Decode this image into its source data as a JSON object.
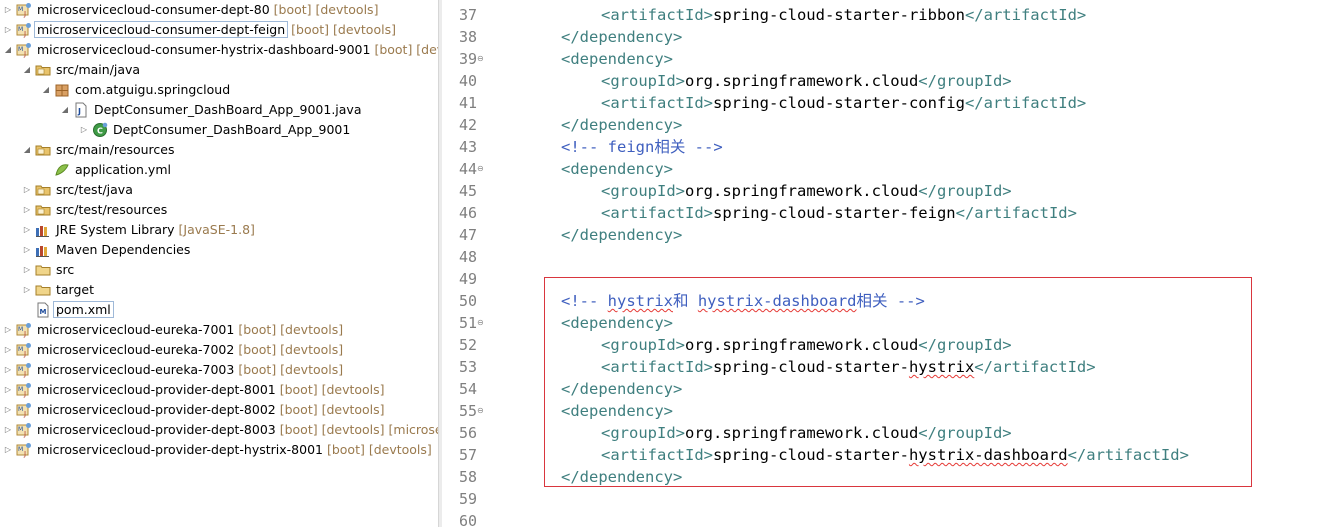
{
  "explorer": {
    "rows": [
      {
        "label": "microservicecloud-consumer-dept-80",
        "dec": " [boot] [devtools]",
        "twisty": "▷",
        "icon": "maven-project-icon",
        "indent": 0
      },
      {
        "label": "microservicecloud-consumer-dept-feign",
        "dec": " [boot] [devtools]",
        "twisty": "▷",
        "icon": "maven-project-icon",
        "indent": 0,
        "selected": true
      },
      {
        "label": "microservicecloud-consumer-hystrix-dashboard-9001",
        "dec": " [boot] [devtoo",
        "twisty": "◢",
        "icon": "maven-project-icon",
        "indent": 0
      },
      {
        "label": "src/main/java",
        "dec": "",
        "twisty": "◢",
        "icon": "source-folder-icon",
        "indent": 1
      },
      {
        "label": "com.atguigu.springcloud",
        "dec": "",
        "twisty": "◢",
        "icon": "package-icon",
        "indent": 2
      },
      {
        "label": "DeptConsumer_DashBoard_App_9001.java",
        "dec": "",
        "twisty": "◢",
        "icon": "java-file-icon",
        "indent": 3
      },
      {
        "label": "DeptConsumer_DashBoard_App_9001",
        "dec": "",
        "twisty": "▷",
        "icon": "java-class-icon",
        "indent": 4
      },
      {
        "label": "src/main/resources",
        "dec": "",
        "twisty": "◢",
        "icon": "source-folder-icon",
        "indent": 1
      },
      {
        "label": "application.yml",
        "dec": "",
        "twisty": "",
        "icon": "yml-file-icon",
        "indent": 2
      },
      {
        "label": "src/test/java",
        "dec": "",
        "twisty": "▷",
        "icon": "source-folder-icon",
        "indent": 1
      },
      {
        "label": "src/test/resources",
        "dec": "",
        "twisty": "▷",
        "icon": "source-folder-icon",
        "indent": 1
      },
      {
        "label": "JRE System Library",
        "dec": " [JavaSE-1.8]",
        "twisty": "▷",
        "icon": "library-icon",
        "indent": 1
      },
      {
        "label": "Maven Dependencies",
        "dec": "",
        "twisty": "▷",
        "icon": "library-icon",
        "indent": 1
      },
      {
        "label": "src",
        "dec": "",
        "twisty": "▷",
        "icon": "folder-icon",
        "indent": 1
      },
      {
        "label": "target",
        "dec": "",
        "twisty": "▷",
        "icon": "folder-icon",
        "indent": 1
      },
      {
        "label": "pom.xml",
        "dec": "",
        "twisty": "",
        "icon": "pom-file-icon",
        "indent": 1,
        "boxed": true
      },
      {
        "label": "microservicecloud-eureka-7001",
        "dec": " [boot] [devtools]",
        "twisty": "▷",
        "icon": "maven-project-icon",
        "indent": 0
      },
      {
        "label": "microservicecloud-eureka-7002",
        "dec": " [boot] [devtools]",
        "twisty": "▷",
        "icon": "maven-project-icon",
        "indent": 0
      },
      {
        "label": "microservicecloud-eureka-7003",
        "dec": " [boot] [devtools]",
        "twisty": "▷",
        "icon": "maven-project-icon",
        "indent": 0
      },
      {
        "label": "microservicecloud-provider-dept-8001",
        "dec": " [boot] [devtools]",
        "twisty": "▷",
        "icon": "maven-project-icon",
        "indent": 0
      },
      {
        "label": "microservicecloud-provider-dept-8002",
        "dec": " [boot] [devtools]",
        "twisty": "▷",
        "icon": "maven-project-icon",
        "indent": 0
      },
      {
        "label": "microservicecloud-provider-dept-8003",
        "dec": " [boot] [devtools] [microservi",
        "twisty": "▷",
        "icon": "maven-project-icon",
        "indent": 0
      },
      {
        "label": "microservicecloud-provider-dept-hystrix-8001",
        "dec": " [boot] [devtools]",
        "twisty": "▷",
        "icon": "maven-project-icon",
        "indent": 0
      }
    ]
  },
  "editor": {
    "lines": [
      {
        "n": "37",
        "fold": "",
        "indent": 2,
        "tokens": [
          [
            "tg",
            "<artifactId>"
          ],
          [
            "tx",
            "spring-cloud-starter-ribbon"
          ],
          [
            "tg",
            "</artifactId>"
          ]
        ]
      },
      {
        "n": "38",
        "fold": "",
        "indent": 1,
        "tokens": [
          [
            "tg",
            "</dependency>"
          ]
        ]
      },
      {
        "n": "39",
        "fold": "⊖",
        "indent": 1,
        "tokens": [
          [
            "tg",
            "<dependency>"
          ]
        ]
      },
      {
        "n": "40",
        "fold": "",
        "indent": 2,
        "tokens": [
          [
            "tg",
            "<groupId>"
          ],
          [
            "tx",
            "org.springframework.cloud"
          ],
          [
            "tg",
            "</groupId>"
          ]
        ]
      },
      {
        "n": "41",
        "fold": "",
        "indent": 2,
        "tokens": [
          [
            "tg",
            "<artifactId>"
          ],
          [
            "tx",
            "spring-cloud-starter-config"
          ],
          [
            "tg",
            "</artifactId>"
          ]
        ]
      },
      {
        "n": "42",
        "fold": "",
        "indent": 1,
        "tokens": [
          [
            "tg",
            "</dependency>"
          ]
        ]
      },
      {
        "n": "43",
        "fold": "",
        "indent": 1,
        "tokens": [
          [
            "cm",
            "<!-- feign相关 -->"
          ]
        ]
      },
      {
        "n": "44",
        "fold": "⊖",
        "indent": 1,
        "tokens": [
          [
            "tg",
            "<dependency>"
          ]
        ]
      },
      {
        "n": "45",
        "fold": "",
        "indent": 2,
        "tokens": [
          [
            "tg",
            "<groupId>"
          ],
          [
            "tx",
            "org.springframework.cloud"
          ],
          [
            "tg",
            "</groupId>"
          ]
        ]
      },
      {
        "n": "46",
        "fold": "",
        "indent": 2,
        "tokens": [
          [
            "tg",
            "<artifactId>"
          ],
          [
            "tx",
            "spring-cloud-starter-feign"
          ],
          [
            "tg",
            "</artifactId>"
          ]
        ]
      },
      {
        "n": "47",
        "fold": "",
        "indent": 1,
        "tokens": [
          [
            "tg",
            "</dependency>"
          ]
        ]
      },
      {
        "n": "48",
        "fold": "",
        "indent": 0,
        "tokens": []
      },
      {
        "n": "49",
        "fold": "",
        "indent": 0,
        "tokens": []
      },
      {
        "n": "50",
        "fold": "",
        "indent": 1,
        "tokens": [
          [
            "cm",
            "<!-- "
          ],
          [
            "cm sq",
            "hystrix"
          ],
          [
            "cm",
            "和 "
          ],
          [
            "cm sq",
            "hystrix-dashboard"
          ],
          [
            "cm",
            "相关 -->"
          ]
        ]
      },
      {
        "n": "51",
        "fold": "⊖",
        "indent": 1,
        "tokens": [
          [
            "tg",
            "<dependency>"
          ]
        ]
      },
      {
        "n": "52",
        "fold": "",
        "indent": 2,
        "tokens": [
          [
            "tg",
            "<groupId>"
          ],
          [
            "tx",
            "org.springframework.cloud"
          ],
          [
            "tg",
            "</groupId>"
          ]
        ]
      },
      {
        "n": "53",
        "fold": "",
        "indent": 2,
        "tokens": [
          [
            "tg",
            "<artifactId>"
          ],
          [
            "tx",
            "spring-cloud-starter-"
          ],
          [
            "tx sq",
            "hystrix"
          ],
          [
            "tg",
            "</artifactId>"
          ]
        ]
      },
      {
        "n": "54",
        "fold": "",
        "indent": 1,
        "tokens": [
          [
            "tg",
            "</dependency>"
          ]
        ]
      },
      {
        "n": "55",
        "fold": "⊖",
        "indent": 1,
        "tokens": [
          [
            "tg",
            "<dependency>"
          ]
        ]
      },
      {
        "n": "56",
        "fold": "",
        "indent": 2,
        "tokens": [
          [
            "tg",
            "<groupId>"
          ],
          [
            "tx",
            "org.springframework.cloud"
          ],
          [
            "tg",
            "</groupId>"
          ]
        ]
      },
      {
        "n": "57",
        "fold": "",
        "indent": 2,
        "tokens": [
          [
            "tg",
            "<artifactId>"
          ],
          [
            "tx",
            "spring-cloud-starter-"
          ],
          [
            "tx sq",
            "hystrix-dashboard"
          ],
          [
            "tg",
            "</artifactId>"
          ]
        ]
      },
      {
        "n": "58",
        "fold": "",
        "indent": 1,
        "tokens": [
          [
            "tg",
            "</dependency>"
          ]
        ]
      },
      {
        "n": "59",
        "fold": "",
        "indent": 0,
        "tokens": []
      },
      {
        "n": "60",
        "fold": "",
        "indent": 0,
        "tokens": []
      }
    ]
  },
  "colors": {
    "tag": "#3f7f7f",
    "comment": "#3f5fbf",
    "decoration": "#9a7a4e",
    "highlight_box": "#d9363e"
  }
}
